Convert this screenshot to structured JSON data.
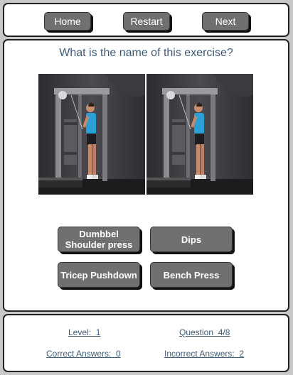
{
  "nav": {
    "home_label": "Home",
    "restart_label": "Restart",
    "next_label": "Next"
  },
  "quiz": {
    "question": "What is the name of this exercise?",
    "image_icon": "cable-machine-exercise-photo",
    "answers": [
      "Dumbbel Shoulder press",
      "Dips",
      "Tricep Pushdown",
      "Bench Press"
    ]
  },
  "stats": {
    "level": "Level:  1",
    "question": "Question  4/8",
    "correct": "Correct Answers:  0",
    "incorrect": "Incorrect Answers:  2"
  },
  "colors": {
    "button_bg": "#707070",
    "text_accent": "#3d5a7a",
    "page_bg": "#c8c8c8"
  }
}
